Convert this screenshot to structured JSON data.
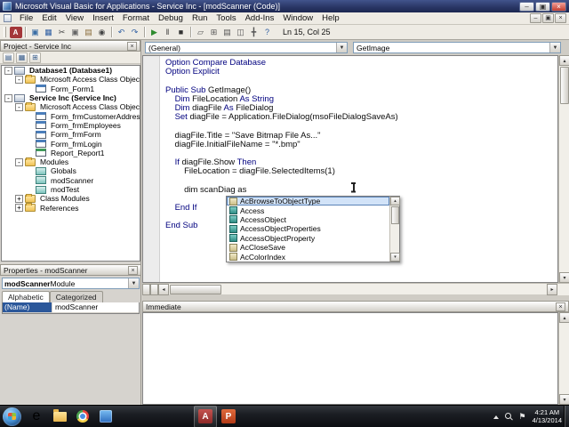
{
  "titlebar": {
    "title": "Microsoft Visual Basic for Applications - Service Inc - [modScanner (Code)]"
  },
  "glyphs": {
    "minimize": "–",
    "maximize": "▣",
    "close": "×",
    "dropdown": "▼",
    "up": "▴",
    "down": "▾",
    "left": "◂",
    "right": "▸"
  },
  "menu": {
    "items": [
      "File",
      "Edit",
      "View",
      "Insert",
      "Format",
      "Debug",
      "Run",
      "Tools",
      "Add-Ins",
      "Window",
      "Help"
    ]
  },
  "toolbar": {
    "position": "Ln 15, Col 25",
    "icons": [
      {
        "name": "view-microsoft-access",
        "glyph": "A",
        "fg": "#ffffff",
        "bg": "#a4373a"
      },
      {
        "name": "separator"
      },
      {
        "name": "insert-module",
        "glyph": "▣",
        "fg": "#3a6ea5"
      },
      {
        "name": "save",
        "glyph": "▦",
        "fg": "#2f5fa3"
      },
      {
        "name": "cut",
        "glyph": "✂",
        "fg": "#444444"
      },
      {
        "name": "copy",
        "glyph": "▣",
        "fg": "#666666"
      },
      {
        "name": "paste",
        "glyph": "▤",
        "fg": "#8a6d3b"
      },
      {
        "name": "find",
        "glyph": "◉",
        "fg": "#444444"
      },
      {
        "name": "separator"
      },
      {
        "name": "undo",
        "glyph": "↶",
        "fg": "#2f5fa3"
      },
      {
        "name": "redo",
        "glyph": "↷",
        "fg": "#2f5fa3"
      },
      {
        "name": "separator"
      },
      {
        "name": "run-sub",
        "glyph": "▶",
        "fg": "#2e8b2e"
      },
      {
        "name": "break",
        "glyph": "‖",
        "fg": "#333333"
      },
      {
        "name": "reset",
        "glyph": "■",
        "fg": "#333333"
      },
      {
        "name": "separator"
      },
      {
        "name": "design-mode",
        "glyph": "▱",
        "fg": "#555555"
      },
      {
        "name": "project-explorer",
        "glyph": "⊞",
        "fg": "#555555"
      },
      {
        "name": "properties-window",
        "glyph": "▤",
        "fg": "#555555"
      },
      {
        "name": "object-browser",
        "glyph": "◫",
        "fg": "#555555"
      },
      {
        "name": "toolbox",
        "glyph": "╋",
        "fg": "#555555"
      },
      {
        "name": "help",
        "glyph": "?",
        "fg": "#2f5fa3"
      }
    ]
  },
  "project_panel": {
    "title": "Project - Service Inc",
    "tools": [
      {
        "name": "view-code",
        "glyph": "▤"
      },
      {
        "name": "view-object",
        "glyph": "▦"
      },
      {
        "name": "toggle-folders",
        "glyph": "⊞"
      }
    ],
    "tree": [
      {
        "label": "Database1 (Database1)",
        "level": 0,
        "expander": "-",
        "icon": "project",
        "bold": true
      },
      {
        "label": "Microsoft Access Class Objects",
        "level": 1,
        "expander": "-",
        "icon": "folder"
      },
      {
        "label": "Form_Form1",
        "level": 2,
        "expander": "",
        "icon": "form"
      },
      {
        "label": "Service Inc (Service Inc)",
        "level": 0,
        "expander": "-",
        "icon": "project",
        "bold": true
      },
      {
        "label": "Microsoft Access Class Objects",
        "level": 1,
        "expander": "-",
        "icon": "folder"
      },
      {
        "label": "Form_frmCustomerAddresses",
        "level": 2,
        "expander": "",
        "icon": "form"
      },
      {
        "label": "Form_frmEmployees",
        "level": 2,
        "expander": "",
        "icon": "form"
      },
      {
        "label": "Form_frmForm",
        "level": 2,
        "expander": "",
        "icon": "form"
      },
      {
        "label": "Form_frmLogin",
        "level": 2,
        "expander": "",
        "icon": "form"
      },
      {
        "label": "Report_Report1",
        "level": 2,
        "expander": "",
        "icon": "report"
      },
      {
        "label": "Modules",
        "level": 1,
        "expander": "-",
        "icon": "folder"
      },
      {
        "label": "Globals",
        "level": 2,
        "expander": "",
        "icon": "module"
      },
      {
        "label": "modScanner",
        "level": 2,
        "expander": "",
        "icon": "module"
      },
      {
        "label": "modTest",
        "level": 2,
        "expander": "",
        "icon": "module"
      },
      {
        "label": "Class Modules",
        "level": 1,
        "expander": "+",
        "icon": "folder"
      },
      {
        "label": "References",
        "level": 1,
        "expander": "+",
        "icon": "folder"
      }
    ]
  },
  "properties_panel": {
    "title": "Properties - modScanner",
    "object_name": "modScanner",
    "object_type": " Module",
    "tabs": [
      "Alphabetic",
      "Categorized"
    ],
    "rows": [
      {
        "name": "(Name)",
        "value": "modScanner"
      }
    ]
  },
  "code_window": {
    "left_combo": "(General)",
    "right_combo": "GetImage",
    "lines": [
      {
        "segs": [
          [
            "k",
            "Option Compare Database"
          ]
        ]
      },
      {
        "segs": [
          [
            "k",
            "Option Explicit"
          ]
        ]
      },
      {
        "segs": []
      },
      {
        "segs": [
          [
            "k",
            "Public Sub"
          ],
          [
            "n",
            " GetImage()"
          ]
        ]
      },
      {
        "segs": [
          [
            "n",
            "    "
          ],
          [
            "k",
            "Dim"
          ],
          [
            "n",
            " FileLocation "
          ],
          [
            "k",
            "As String"
          ]
        ]
      },
      {
        "segs": [
          [
            "n",
            "    "
          ],
          [
            "k",
            "Dim"
          ],
          [
            "n",
            " diagFile "
          ],
          [
            "k",
            "As"
          ],
          [
            "n",
            " FileDialog"
          ]
        ]
      },
      {
        "segs": [
          [
            "n",
            "    "
          ],
          [
            "k",
            "Set"
          ],
          [
            "n",
            " diagFile = Application.FileDialog(msoFileDialogSaveAs)"
          ]
        ]
      },
      {
        "segs": []
      },
      {
        "segs": [
          [
            "n",
            "    diagFile.Title = \"Save Bitmap File As...\""
          ]
        ]
      },
      {
        "segs": [
          [
            "n",
            "    diagFile.InitialFileName = \"*.bmp\""
          ]
        ]
      },
      {
        "segs": []
      },
      {
        "segs": [
          [
            "n",
            "    "
          ],
          [
            "k",
            "If"
          ],
          [
            "n",
            " diagFile.Show "
          ],
          [
            "k",
            "Then"
          ]
        ]
      },
      {
        "segs": [
          [
            "n",
            "        FileLocation = diagFile.SelectedItems(1)"
          ]
        ]
      },
      {
        "segs": []
      },
      {
        "segs": [
          [
            "n",
            "        dim scanDiag as "
          ]
        ]
      },
      {
        "segs": []
      },
      {
        "segs": [
          [
            "n",
            "    "
          ],
          [
            "k",
            "End If"
          ]
        ]
      },
      {
        "segs": []
      },
      {
        "segs": [
          [
            "k",
            "End Sub"
          ]
        ]
      }
    ]
  },
  "intellisense": {
    "selected": 0,
    "items": [
      {
        "label": "AcBrowseToObjectType",
        "kind": "enum"
      },
      {
        "label": "Access",
        "kind": "class"
      },
      {
        "label": "AccessObject",
        "kind": "class"
      },
      {
        "label": "AccessObjectProperties",
        "kind": "class"
      },
      {
        "label": "AccessObjectProperty",
        "kind": "class"
      },
      {
        "label": "AcCloseSave",
        "kind": "enum"
      },
      {
        "label": "AcColorIndex",
        "kind": "enum"
      }
    ]
  },
  "immediate": {
    "title": "Immediate"
  },
  "taskbar": {
    "icons": [
      {
        "name": "internet-explorer",
        "label": "e"
      },
      {
        "name": "file-explorer"
      },
      {
        "name": "chrome"
      },
      {
        "name": "app-blue"
      },
      {
        "name": "spacer"
      },
      {
        "name": "access",
        "label": "A",
        "active": true
      },
      {
        "name": "powerpoint",
        "label": "P"
      }
    ],
    "clock_time": "4:21 AM",
    "clock_date": "4/13/2014"
  }
}
